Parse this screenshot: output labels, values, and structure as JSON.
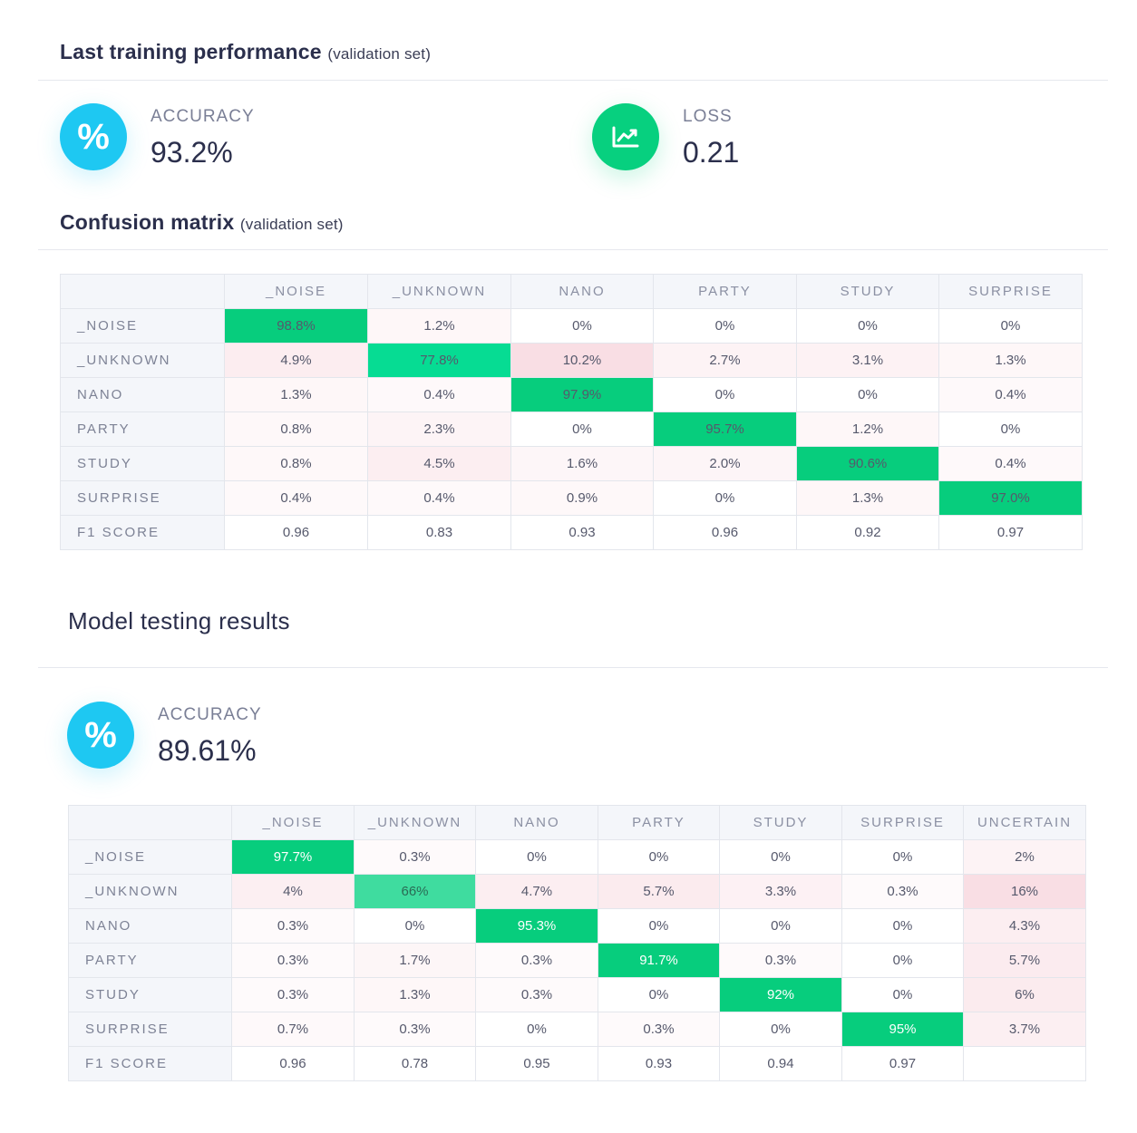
{
  "training": {
    "title": "Last training performance",
    "subtitle": "(validation set)",
    "accuracy_label": "ACCURACY",
    "accuracy_value": "93.2%",
    "loss_label": "LOSS",
    "loss_value": "0.21",
    "percent_glyph": "%"
  },
  "confusion": {
    "title": "Confusion matrix",
    "subtitle": "(validation set)",
    "columns": [
      "_NOISE",
      "_UNKNOWN",
      "NANO",
      "PARTY",
      "STUDY",
      "SURPRISE"
    ],
    "rows": [
      {
        "label": "_NOISE",
        "cells": [
          "98.8%",
          "1.2%",
          "0%",
          "0%",
          "0%",
          "0%"
        ]
      },
      {
        "label": "_UNKNOWN",
        "cells": [
          "4.9%",
          "77.8%",
          "10.2%",
          "2.7%",
          "3.1%",
          "1.3%"
        ]
      },
      {
        "label": "NANO",
        "cells": [
          "1.3%",
          "0.4%",
          "97.9%",
          "0%",
          "0%",
          "0.4%"
        ]
      },
      {
        "label": "PARTY",
        "cells": [
          "0.8%",
          "2.3%",
          "0%",
          "95.7%",
          "1.2%",
          "0%"
        ]
      },
      {
        "label": "STUDY",
        "cells": [
          "0.8%",
          "4.5%",
          "1.6%",
          "2.0%",
          "90.6%",
          "0.4%"
        ]
      },
      {
        "label": "SURPRISE",
        "cells": [
          "0.4%",
          "0.4%",
          "0.9%",
          "0%",
          "1.3%",
          "97.0%"
        ]
      },
      {
        "label": "F1 SCORE",
        "cells": [
          "0.96",
          "0.83",
          "0.93",
          "0.96",
          "0.92",
          "0.97"
        ]
      }
    ]
  },
  "testing": {
    "title": "Model testing results",
    "accuracy_label": "ACCURACY",
    "accuracy_value": "89.61%",
    "percent_glyph": "%",
    "columns": [
      "_NOISE",
      "_UNKNOWN",
      "NANO",
      "PARTY",
      "STUDY",
      "SURPRISE",
      "UNCERTAIN"
    ],
    "rows": [
      {
        "label": "_NOISE",
        "cells": [
          "97.7%",
          "0.3%",
          "0%",
          "0%",
          "0%",
          "0%",
          "2%"
        ]
      },
      {
        "label": "_UNKNOWN",
        "cells": [
          "4%",
          "66%",
          "4.7%",
          "5.7%",
          "3.3%",
          "0.3%",
          "16%"
        ]
      },
      {
        "label": "NANO",
        "cells": [
          "0.3%",
          "0%",
          "95.3%",
          "0%",
          "0%",
          "0%",
          "4.3%"
        ]
      },
      {
        "label": "PARTY",
        "cells": [
          "0.3%",
          "1.7%",
          "0.3%",
          "91.7%",
          "0.3%",
          "0%",
          "5.7%"
        ]
      },
      {
        "label": "STUDY",
        "cells": [
          "0.3%",
          "1.3%",
          "0.3%",
          "0%",
          "92%",
          "0%",
          "6%"
        ]
      },
      {
        "label": "SURPRISE",
        "cells": [
          "0.7%",
          "0.3%",
          "0%",
          "0.3%",
          "0%",
          "95%",
          "3.7%"
        ]
      },
      {
        "label": "F1 SCORE",
        "cells": [
          "0.96",
          "0.78",
          "0.95",
          "0.93",
          "0.94",
          "0.97",
          ""
        ]
      }
    ]
  },
  "colors": {
    "diag_strong": "#07cd7d",
    "diag_light": "#3fdc9f",
    "diag_unknown_validation": "#06dc93",
    "off_diag_tint": "#f5dde2",
    "uncertain_tint": "#f7dbe0",
    "accuracy_icon": "#1ec8f2",
    "loss_icon": "#07d07f"
  },
  "icons": {
    "accuracy": "percent-icon",
    "loss": "trending-chart-icon"
  }
}
